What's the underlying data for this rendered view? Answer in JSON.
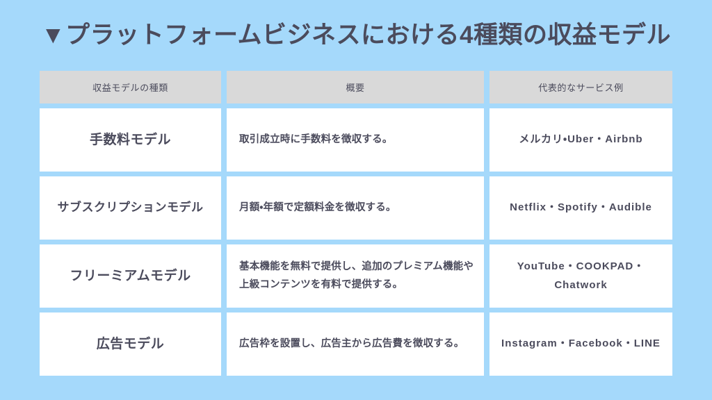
{
  "slide": {
    "background_color": "#a5d9fb",
    "text_color": "#4b4b5c",
    "header_cell_color": "#d9d9d9",
    "body_cell_color": "#ffffff",
    "title": "▼プラットフォームビジネスにおける4種類の収益モデル",
    "title_marker": "▼"
  },
  "table": {
    "headers": [
      "収益モデルの種類",
      "概要",
      "代表的なサービス例"
    ],
    "rows": [
      {
        "model": "手数料モデル",
        "summary": "取引成立時に手数料を徴収する。",
        "examples": "メルカリ・Uber・Airbnb"
      },
      {
        "model": "サブスクリプションモデル",
        "summary": "月額・年額で定額料金を徴収する。",
        "examples": "Netflix・Spotify・Audible"
      },
      {
        "model": "フリーミアムモデル",
        "summary": "基本機能を無料で提供し、追加のプレミアム機能や上級コンテンツを有料で提供する。",
        "examples": "YouTube・COOKPAD・Chatwork"
      },
      {
        "model": "広告モデル",
        "summary": "広告枠を設置し、広告主から広告費を徴収する。",
        "examples": "Instagram・Facebook・LINE"
      }
    ]
  }
}
